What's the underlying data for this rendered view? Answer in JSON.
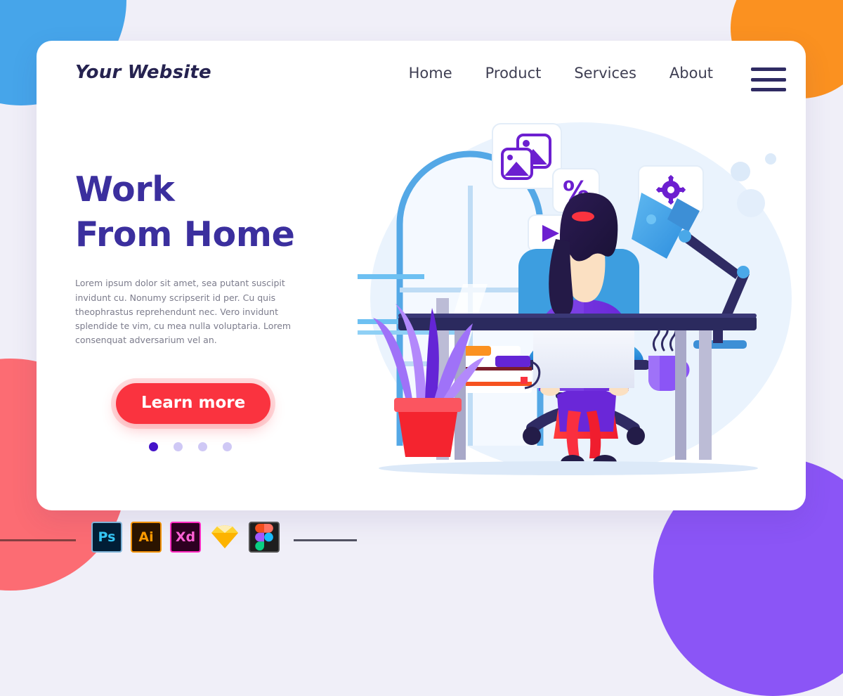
{
  "page": {
    "background_color": "#f0eff8",
    "decor_shapes": [
      {
        "name": "blob-blue",
        "color": "#46a5ea"
      },
      {
        "name": "blob-orange",
        "color": "#fb9120"
      },
      {
        "name": "blob-coral",
        "color": "#fc6c73"
      },
      {
        "name": "blob-purple",
        "color": "#8b55f6"
      }
    ]
  },
  "header": {
    "logo": "Your Website",
    "logo_color": "#262350",
    "nav": [
      {
        "label": "Home"
      },
      {
        "label": "Product"
      },
      {
        "label": "Services"
      },
      {
        "label": "About"
      }
    ],
    "menu_icon": "hamburger-menu-icon",
    "menu_icon_color": "#2f2b63"
  },
  "hero": {
    "title_line1": "Work",
    "title_line2": "From Home",
    "title_color": "#3b2f9e",
    "paragraph": "Lorem ipsum dolor sit amet, sea putant suscipit invidunt cu. Nonumy scripserit id per. Cu quis theophrastus reprehendunt nec. Vero invidunt splendide te vim, cu mea nulla voluptaria. Lorem consenquat adversarium vel an.",
    "cta_label": "Learn more",
    "cta_color": "#fa333f",
    "dots": [
      {
        "active": true,
        "color": "#4412c8"
      },
      {
        "active": false,
        "color": "#cfc8f5"
      },
      {
        "active": false,
        "color": "#cfc8f5"
      },
      {
        "active": false,
        "color": "#cfc8f5"
      }
    ]
  },
  "illustration": {
    "name": "work-from-home-illustration",
    "accent_purple": "#6c1fd0",
    "accent_blue": "#4aa8e8",
    "accent_red": "#fa333f",
    "desk_color": "#2b2a5e",
    "cards": [
      {
        "name": "image-card",
        "icon": "photo-icon"
      },
      {
        "name": "percent-card",
        "icon": "percent-icon",
        "label": "%"
      },
      {
        "name": "play-card",
        "icon": "play-icon"
      },
      {
        "name": "gear-bubble",
        "icon": "gear-icon"
      }
    ],
    "objects": [
      "arched-window",
      "desk",
      "laptop",
      "office-chair",
      "desk-lamp",
      "coffee-mug",
      "book-stack",
      "potted-plant",
      "woman-working"
    ]
  },
  "toolbar": {
    "tools": [
      {
        "name": "photoshop-icon",
        "label": "Ps"
      },
      {
        "name": "illustrator-icon",
        "label": "Ai"
      },
      {
        "name": "xd-icon",
        "label": "Xd"
      },
      {
        "name": "sketch-icon",
        "label": ""
      },
      {
        "name": "figma-icon",
        "label": ""
      }
    ]
  }
}
